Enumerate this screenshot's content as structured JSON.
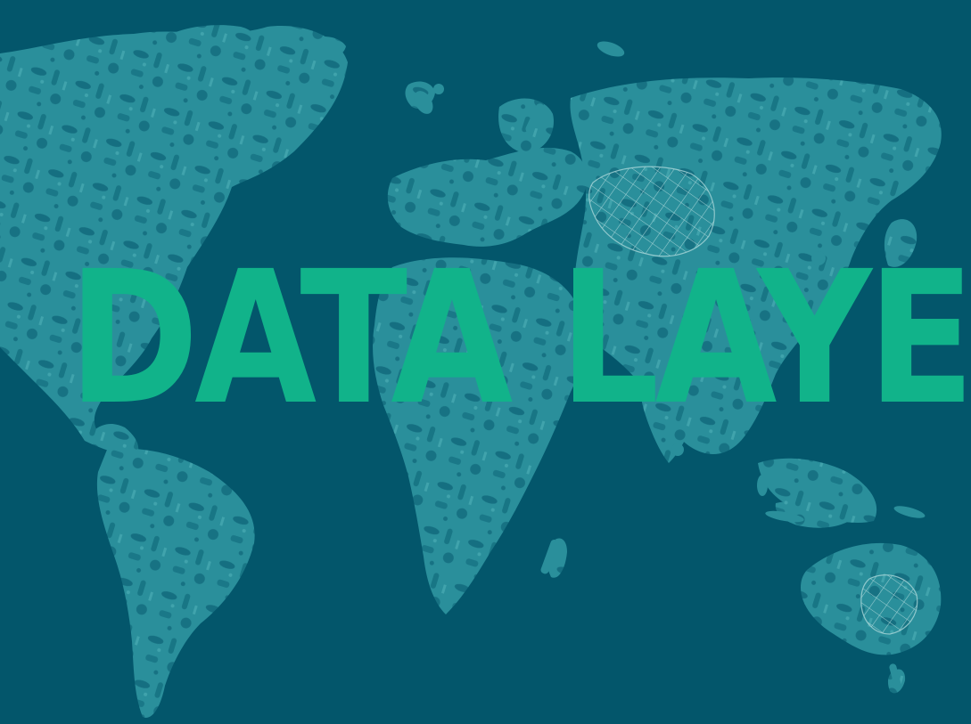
{
  "title": "DATA LAYER",
  "colors": {
    "background": "#03566b",
    "map_fill": "#2a8f9b",
    "map_detail": "#4fb0b8",
    "net_line": "#a9d6d8",
    "title": "#11b38a"
  },
  "artwork": {
    "subject": "world-map",
    "pattern": "plastic-debris-silhouettes"
  }
}
